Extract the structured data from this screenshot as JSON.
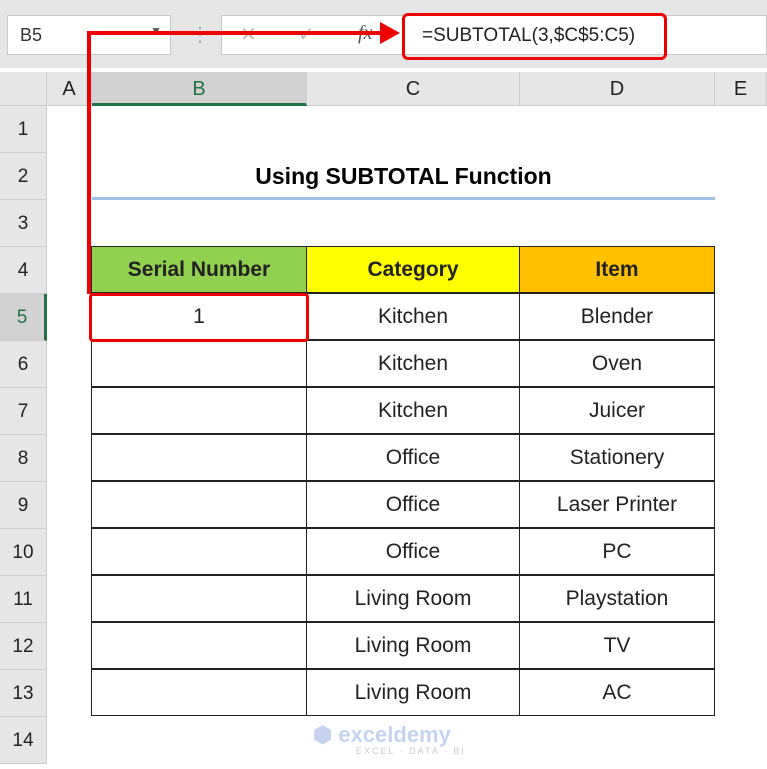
{
  "name_box": "B5",
  "formula": "=SUBTOTAL(3,$C$5:C5)",
  "columns": [
    "A",
    "B",
    "C",
    "D",
    "E"
  ],
  "rows": [
    "1",
    "2",
    "3",
    "4",
    "5",
    "6",
    "7",
    "8",
    "9",
    "10",
    "11",
    "12",
    "13",
    "14"
  ],
  "title": "Using SUBTOTAL Function",
  "table": {
    "headers": [
      "Serial Number",
      "Category",
      "Item"
    ],
    "header_colors": [
      "#92d050",
      "#ffff00",
      "#ffc000"
    ],
    "rows": [
      [
        "1",
        "Kitchen",
        "Blender"
      ],
      [
        "",
        "Kitchen",
        "Oven"
      ],
      [
        "",
        "Kitchen",
        "Juicer"
      ],
      [
        "",
        "Office",
        "Stationery"
      ],
      [
        "",
        "Office",
        "Laser Printer"
      ],
      [
        "",
        "Office",
        "PC"
      ],
      [
        "",
        "Living Room",
        "Playstation"
      ],
      [
        "",
        "Living Room",
        "TV"
      ],
      [
        "",
        "Living Room",
        "AC"
      ]
    ]
  },
  "watermark": {
    "name": "exceldemy",
    "tagline": "EXCEL · DATA · BI"
  },
  "highlight_color": "#e00000"
}
